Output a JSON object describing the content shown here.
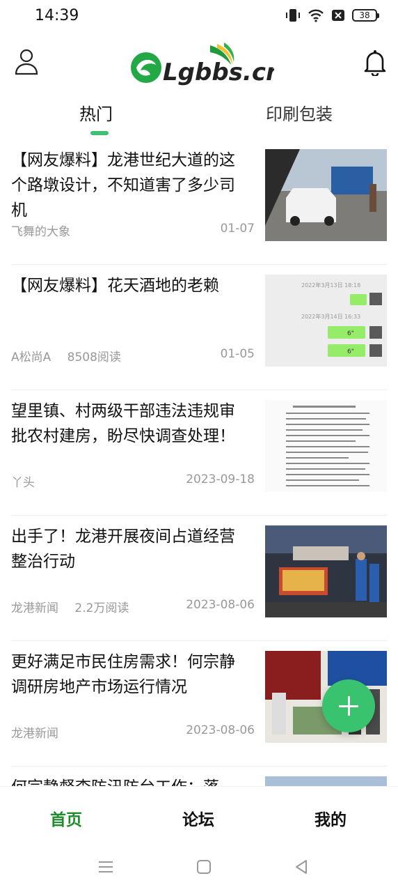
{
  "status_bar": {
    "time": "14:39",
    "battery": "38"
  },
  "header": {
    "logo_text": "Lgbbs.cn"
  },
  "tabs": [
    {
      "label": "热门",
      "active": true
    },
    {
      "label": "印刷包装",
      "active": false
    }
  ],
  "feed": [
    {
      "title": "【网友爆料】龙港世纪大道的这个路墩设计，不知道害了多少司机",
      "author": "飞舞的大象",
      "reads": "",
      "date": "01-07",
      "thumb": "street-car-photo"
    },
    {
      "title": "【网友爆料】花天酒地的老赖",
      "author": "A松尚A",
      "reads": "8508阅读",
      "date": "01-05",
      "thumb": "chat-screenshot",
      "chat": {
        "time1": "2022年3月13日 18:18",
        "time2": "2022年3月14日 16:33",
        "voice1": "6\"",
        "voice2": "6\""
      }
    },
    {
      "title": "望里镇、村两级干部违法违规审批农村建房，盼尽快调查处理！",
      "author": "丫头",
      "reads": "",
      "date": "2023-09-18",
      "thumb": "document-scan"
    },
    {
      "title": "出手了！龙港开展夜间占道经营整治行动",
      "author": "龙港新闻",
      "reads": "2.2万阅读",
      "date": "2023-08-06",
      "thumb": "night-market-photo"
    },
    {
      "title": "更好满足市民住房需求！何宗静调研房地产市场运行情况",
      "author": "龙港新闻",
      "reads": "",
      "date": "2023-08-06",
      "thumb": "real-estate-photo"
    },
    {
      "title": "何宗静督查防汛防台工作：落",
      "author": "",
      "reads": "",
      "date": "",
      "thumb": "building-photo"
    }
  ],
  "bottom_nav": {
    "home": "首页",
    "forum": "论坛",
    "mine": "我的"
  },
  "colors": {
    "accent": "#3ac36e",
    "active_nav": "#1e8c2c"
  }
}
